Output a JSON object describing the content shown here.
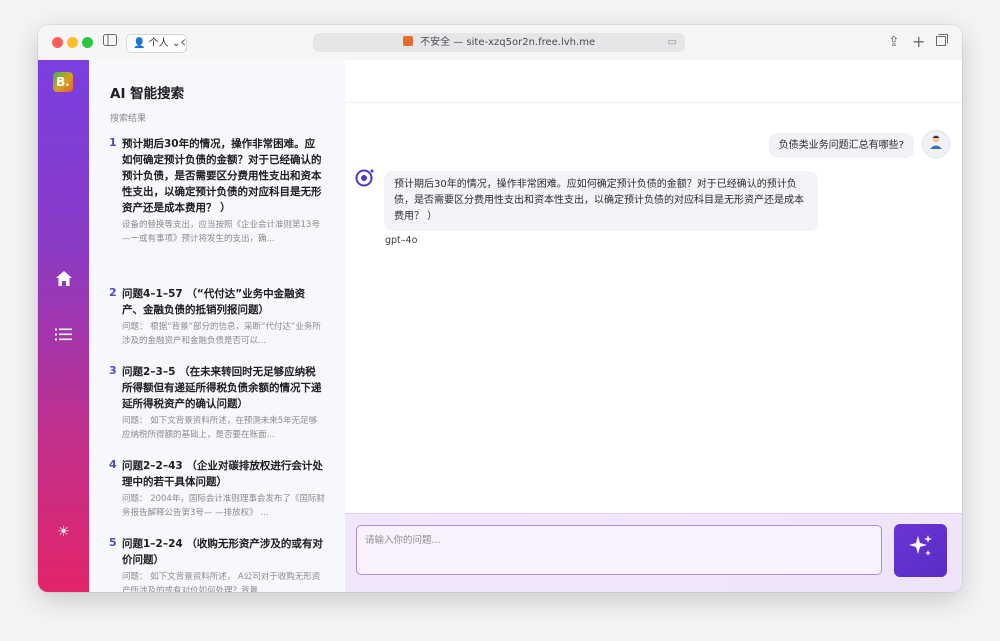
{
  "browser": {
    "profile_label": "个人",
    "url_text": "不安全 — site-xzq5or2n.free.lvh.me"
  },
  "app": {
    "logo_letter": "B."
  },
  "results": {
    "title": "AI 智能搜索",
    "subtitle": "搜索结果",
    "items": [
      {
        "num": "1",
        "title": "预计期后30年的情况，操作非常困难。应如何确定预计负债的金额？对于已经确认的预计负债，是否需要区分费用性支出和资本性支出，以确定预计负债的对应科目是无形资产还是成本费用？ ）",
        "desc": "设备的替换等支出，应当按照《企业会计准则第13号—一或有事项》预计将发生的支出，确..."
      },
      {
        "num": "2",
        "title": "问题4–1–57 （“代付达”业务中金融资产、金融负债的抵销列报问题）",
        "desc": "问题： 根据“背景”部分的信息，采断“代付达”业务所涉及的金融资产和金融负债是否可以..."
      },
      {
        "num": "3",
        "title": "问题2–3–5 （在未来转回时无足够应纳税所得额但有递延所得税负债余额的情况下递延所得税资产的确认问题）",
        "desc": "问题： 如下文背景资料所述，在预测未来5年无足够应纳税所得额的基础上，是否要在账面..."
      },
      {
        "num": "4",
        "title": "问题2–2–43 （企业对碳排放权进行会计处理中的若干具体问题）",
        "desc": "问题： 2004年，国际会计准则理事会发布了《国际财务报告解释公告第3号— —排放权》 ..."
      },
      {
        "num": "5",
        "title": "问题1–2–24 （收购无形资产涉及的或有对价问题）",
        "desc": "问题： 如下文背景资料所述， A公司对于收购无形资产所涉及的或有对价如何处理？背景..."
      }
    ]
  },
  "chat": {
    "user_message": "负债类业务问题汇总有哪些?",
    "bot_message": "预计期后30年的情况，操作非常困难。应如何确定预计负债的金额？对于已经确认的预计负债，是否需要区分费用性支出和资本性支出，以确定预计负债的对应科目是无形资产还是成本费用？ ）",
    "model_label": "gpt–4o",
    "input_placeholder": "请输入你的问题..."
  },
  "colors": {
    "accent": "#5a2dc4",
    "rail_top": "#7b3fe0",
    "rail_bottom": "#e3246a",
    "highlight": "#6a3fd0"
  },
  "icons": [
    "sidebar-toggle-icon",
    "user-icon",
    "chevron-down-icon",
    "back-icon",
    "share-icon",
    "plus-icon",
    "tabs-icon",
    "home-icon",
    "list-icon",
    "sun-icon",
    "ai-bot-icon",
    "sparkle-icon"
  ]
}
